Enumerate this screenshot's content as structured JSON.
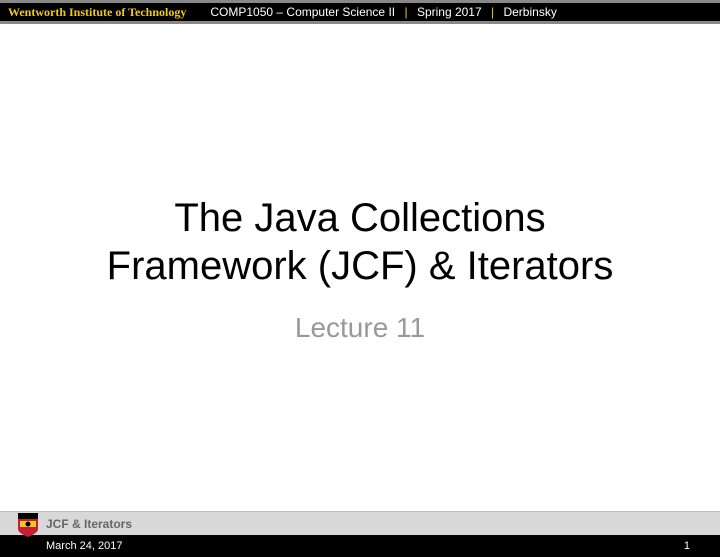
{
  "header": {
    "institute": "Wentworth Institute of Technology",
    "course": "COMP1050 – Computer Science II",
    "term": "Spring 2017",
    "instructor": "Derbinsky"
  },
  "main": {
    "title_line1": "The Java Collections",
    "title_line2": "Framework (JCF) & Iterators",
    "subtitle": "Lecture 11"
  },
  "footer": {
    "topic": "JCF & Iterators",
    "date": "March 24, 2017",
    "page": "1"
  }
}
